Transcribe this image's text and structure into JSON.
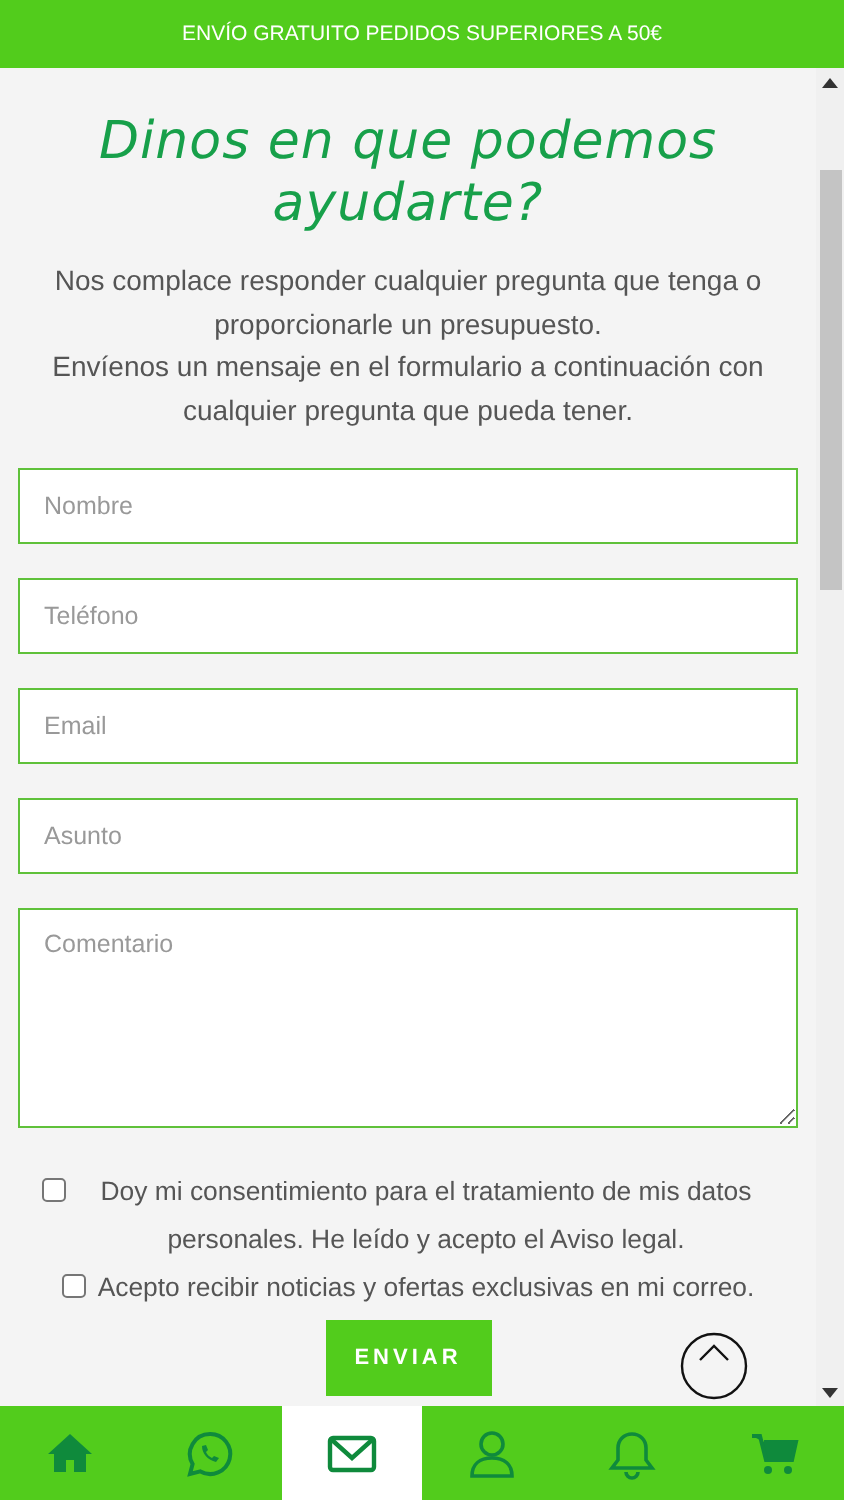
{
  "banner": {
    "text": "ENVÍO GRATUITO PEDIDOS SUPERIORES A 50€"
  },
  "heading": "Dinos en que podemos ayudarte?",
  "intro": [
    "Nos complace responder cualquier pregunta que tenga o proporcionarle un presupuesto.",
    "Envíenos un mensaje en el formulario a continuación con cualquier pregunta que pueda tener."
  ],
  "form": {
    "fields": [
      {
        "kind": "input",
        "placeholder": "Nombre"
      },
      {
        "kind": "input",
        "placeholder": "Teléfono"
      },
      {
        "kind": "input",
        "placeholder": "Email"
      },
      {
        "kind": "input",
        "placeholder": "Asunto"
      },
      {
        "kind": "textarea",
        "placeholder": "Comentario"
      }
    ],
    "consents": [
      {
        "label": "Doy mi consentimiento para el tratamiento de mis datos personales. He leído y acepto el Aviso legal.",
        "checked": false
      },
      {
        "label": "Acepto recibir noticias y ofertas exclusivas en mi correo.",
        "checked": false
      }
    ],
    "submit": "ENVIAR"
  },
  "bottom_nav": [
    {
      "kind": "home",
      "selected": false
    },
    {
      "kind": "whatsapp",
      "selected": false
    },
    {
      "kind": "mail",
      "selected": true
    },
    {
      "kind": "user",
      "selected": false
    },
    {
      "kind": "bell",
      "selected": false
    },
    {
      "kind": "cart",
      "selected": false
    }
  ]
}
